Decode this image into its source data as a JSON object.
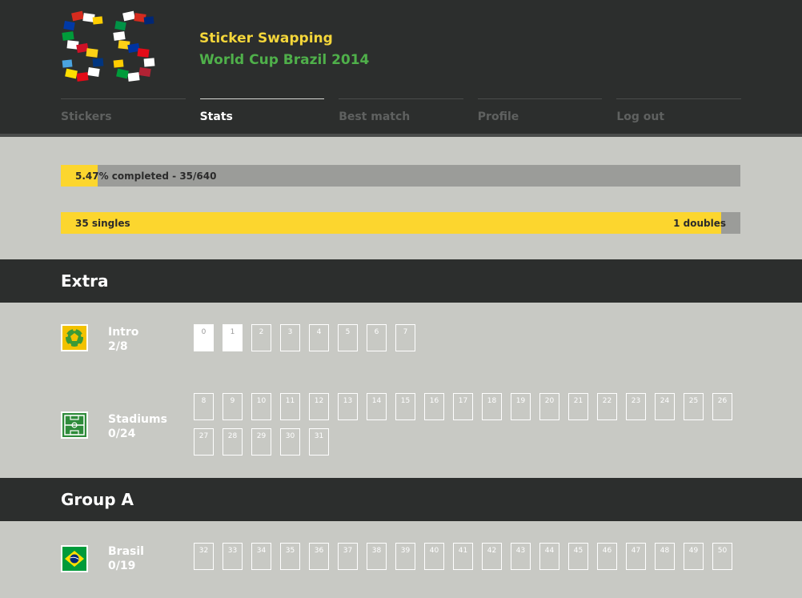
{
  "app": {
    "title": "Sticker Swapping",
    "subtitle": "World Cup Brazil 2014",
    "logo_letters": "SS"
  },
  "nav": {
    "items": [
      {
        "label": "Stickers",
        "active": false
      },
      {
        "label": "Stats",
        "active": true
      },
      {
        "label": "Best match",
        "active": false
      },
      {
        "label": "Profile",
        "active": false
      },
      {
        "label": "Log out",
        "active": false
      }
    ]
  },
  "progress": {
    "completed_label": "5.47% completed - 35/640",
    "completed_fraction": 0.0547,
    "singles_label": "35 singles",
    "doubles_label": "1 doubles",
    "singles_fraction": 0.972
  },
  "colors": {
    "header_bg": "#2c2e2d",
    "page_bg": "#c8c9c4",
    "accent_yellow": "#fcd62e",
    "title_yellow": "#f4d63a",
    "title_green": "#4fb04a",
    "bar_bg": "#9b9c99"
  },
  "sections": [
    {
      "title": "Extra",
      "rows": [
        {
          "name": "Intro",
          "count": "2/8",
          "icon": "soccer-ball-icon",
          "stickers": [
            "0",
            "1",
            "2",
            "3",
            "4",
            "5",
            "6",
            "7"
          ],
          "owned": [
            "0",
            "1"
          ]
        },
        {
          "name": "Stadiums",
          "count": "0/24",
          "icon": "stadium-field-icon",
          "stickers": [
            "8",
            "9",
            "10",
            "11",
            "12",
            "13",
            "14",
            "15",
            "16",
            "17",
            "18",
            "19",
            "20",
            "21",
            "22",
            "23",
            "24",
            "25",
            "26",
            "27",
            "28",
            "29",
            "30",
            "31"
          ],
          "owned": []
        }
      ]
    },
    {
      "title": "Group A",
      "rows": [
        {
          "name": "Brasil",
          "count": "0/19",
          "icon": "brazil-flag-icon",
          "stickers": [
            "32",
            "33",
            "34",
            "35",
            "36",
            "37",
            "38",
            "39",
            "40",
            "41",
            "42",
            "43",
            "44",
            "45",
            "46",
            "47",
            "48",
            "49",
            "50"
          ],
          "owned": []
        }
      ]
    }
  ]
}
